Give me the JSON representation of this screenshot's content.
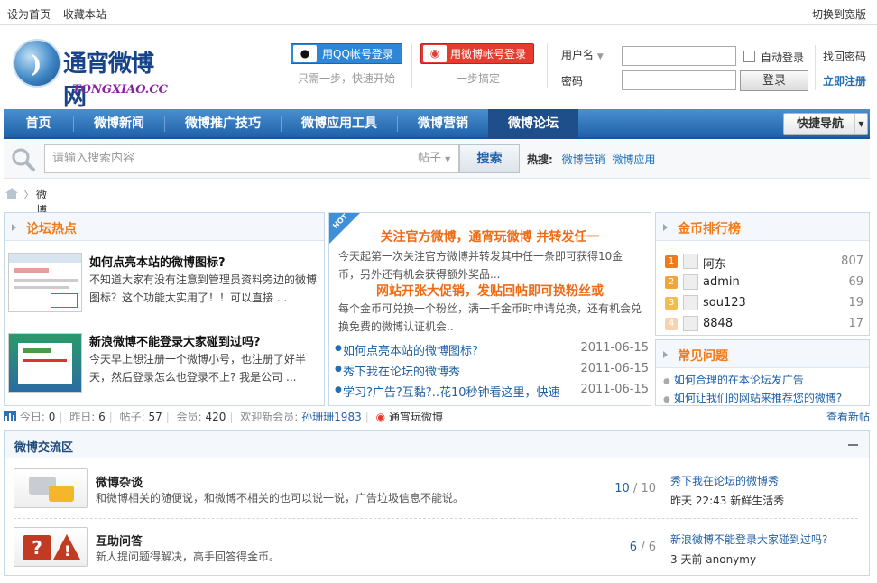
{
  "topbar": {
    "set_home": "设为首页",
    "bookmark": "收藏本站",
    "switch_width": "切换到宽版"
  },
  "logo": {
    "name": "通宵微博网",
    "domain": "TONGXIAO.CC"
  },
  "social_login": {
    "qq_label": "用QQ帐号登录",
    "qq_hint": "只需一步，快速开始",
    "weibo_label": "用微博帐号登录",
    "weibo_hint": "一步搞定"
  },
  "login": {
    "username_label": "用户名",
    "password_label": "密码",
    "auto_login": "自动登录",
    "login_button": "登录",
    "find_password": "找回密码",
    "register": "立即注册"
  },
  "nav": {
    "items": [
      "首页",
      "微博新闻",
      "微博推广技巧",
      "微博应用工具",
      "微博营销",
      "微博论坛"
    ],
    "active": "微博论坛",
    "quick_nav": "快捷导航"
  },
  "search": {
    "placeholder": "请输入搜索内容",
    "type": "帖子",
    "button": "搜索",
    "hot_label": "热搜:",
    "hot_terms": [
      "微博营销",
      "微博应用"
    ]
  },
  "breadcrumb": {
    "current": "微博论坛"
  },
  "hot_panel": {
    "title": "论坛热点",
    "items": [
      {
        "title": "如何点亮本站的微博图标?",
        "desc": "不知道大家有没有注意到管理员资料旁边的微博图标？这个功能太实用了！！可以直接 ..."
      },
      {
        "title": "新浪微博不能登录大家碰到过吗?",
        "desc": "今天早上想注册一个微博小号，也注册了好半天，然后登录怎么也登录不上? 我是公司 ..."
      }
    ]
  },
  "promo_panel": {
    "badge": "HOT",
    "headline1": "关注官方微博，通宵玩微博 并转发任一",
    "text1": "今天起第一次关注官方微博并转发其中任一条即可获得10金币，另外还有机会获得额外奖品...",
    "headline2": "网站开张大促销，发贴回帖即可换粉丝或",
    "text2": "每个金币可兑换一个粉丝，满一千金币时申请兑换，还有机会兑换免费的微博认证机会..",
    "threads": [
      {
        "title": "如何点亮本站的微博图标?",
        "date": "2011-06-15"
      },
      {
        "title": "秀下我在论坛的微博秀",
        "date": "2011-06-15"
      },
      {
        "title": "学习?广告?互黏?..花10秒钟看这里，快速",
        "date": "2011-06-15"
      }
    ]
  },
  "ranking": {
    "title": "金币排行榜",
    "rows": [
      {
        "rank": "1",
        "name": "阿东",
        "coins": "807",
        "color": "#f07b1b"
      },
      {
        "rank": "2",
        "name": "admin",
        "coins": "69",
        "color": "#f3a53a"
      },
      {
        "rank": "3",
        "name": "sou123",
        "coins": "19",
        "color": "#f3bd4a"
      },
      {
        "rank": "4",
        "name": "8848",
        "coins": "17",
        "color": "#f7d2b0"
      }
    ]
  },
  "faq": {
    "title": "常见问题",
    "items": [
      "如何合理的在本论坛发广告",
      "如何让我们的网站来推荐您的微博?"
    ]
  },
  "stats": {
    "today_label": "今日:",
    "today": "0",
    "yesterday_label": "昨日:",
    "yesterday": "6",
    "posts_label": "帖子:",
    "posts": "57",
    "members_label": "会员:",
    "members": "420",
    "welcome": "欢迎新会员:",
    "new_member": "孙珊珊1983",
    "weibo_name": "通宵玩微博",
    "view_new": "查看新帖"
  },
  "forum": {
    "title": "微博交流区",
    "rows": [
      {
        "name": "微博杂谈",
        "desc": "和微博相关的随便说，和微博不相关的也可以说一说，广告垃圾信息不能说。",
        "threads": "10",
        "posts": "10",
        "last_title": "秀下我在论坛的微博秀",
        "last_meta": "昨天 22:43 新鲜生活秀"
      },
      {
        "name": "互助问答",
        "desc": "新人提问题得解决，高手回答得金币。",
        "threads": "6",
        "posts": "6",
        "last_title": "新浪微博不能登录大家碰到过吗?",
        "last_meta": "3 天前 anonymy"
      }
    ]
  }
}
